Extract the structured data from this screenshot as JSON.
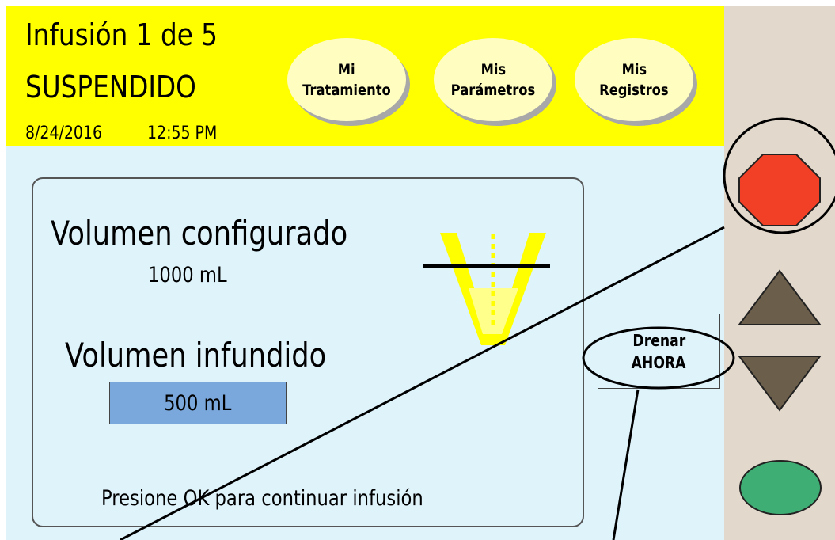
{
  "header": {
    "title": "Infusión 1 de 5",
    "status": "SUSPENDIDO",
    "date": "8/24/2016",
    "time": "12:55 PM",
    "nav": [
      {
        "line1": "Mi",
        "line2": "Tratamiento"
      },
      {
        "line1": "Mis",
        "line2": "Parámetros"
      },
      {
        "line1": "Mis",
        "line2": "Registros"
      }
    ]
  },
  "panel": {
    "configured_label": "Volumen configurado",
    "configured_value": "1000 mL",
    "infused_label": "Volumen infundido",
    "infused_value": "500 mL",
    "hint": "Presione OK para continuar infusión",
    "fill_fraction": 0.5
  },
  "drain_button": {
    "line1": "Drenar",
    "line2": "AHORA"
  },
  "side_buttons": [
    "stop-icon",
    "up-arrow-icon",
    "down-arrow-icon",
    "ok-icon"
  ],
  "colors": {
    "header": "#ffff00",
    "screen": "#dff3fb",
    "side_panel": "#e2d8cb",
    "stop": "#f24026",
    "ok": "#3fae74",
    "arrows": "#6b5e4a",
    "infused_box": "#7aa7dc",
    "container": "#ffff00"
  }
}
